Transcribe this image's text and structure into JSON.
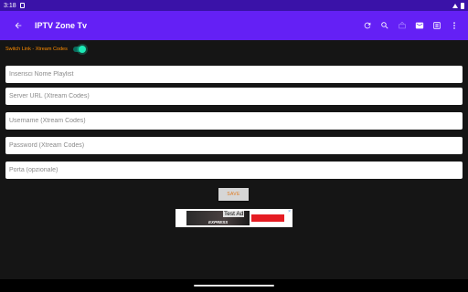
{
  "status_bar": {
    "time": "3:18"
  },
  "app_bar": {
    "title": "IPTV Zone Tv",
    "actions": [
      "refresh-icon",
      "search-icon",
      "tv-icon",
      "mail-icon",
      "list-icon",
      "more-vert-icon"
    ]
  },
  "switch": {
    "label": "Switch Link - Xtream Codes",
    "checked": true,
    "accent": "#1de9b6"
  },
  "fields": {
    "playlist_name": "Inserisci Nome Playlist",
    "server_url": "Server URL (Xtream Codes)",
    "username": "Username (Xtream Codes)",
    "password": "Password (Xtream Codes)",
    "port": "Porta (opzionale)"
  },
  "save_label": "SAVE",
  "ad": {
    "label": "Test Ad",
    "image_text": "EXPRESS",
    "close": "×"
  },
  "colors": {
    "app_bar": "#6420f5",
    "status_bar": "#3a12a8",
    "background": "#151515",
    "switch_label": "#ff8c00"
  }
}
